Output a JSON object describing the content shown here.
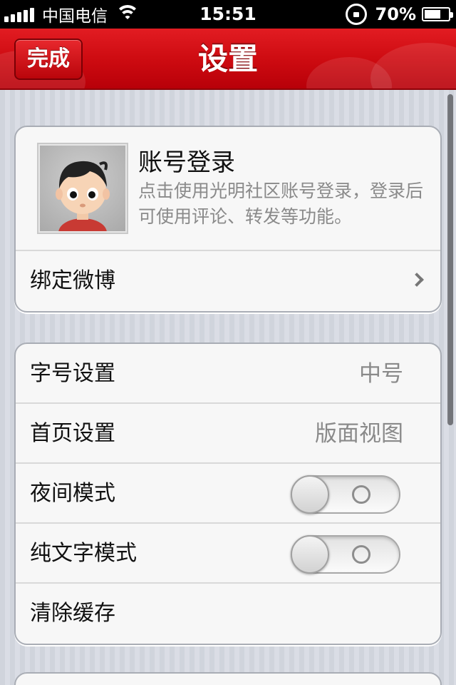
{
  "status_bar": {
    "carrier": "中国电信",
    "time": "15:51",
    "battery_percent": "70%",
    "battery_level": 0.7
  },
  "nav": {
    "title": "设置",
    "done_label": "完成"
  },
  "account": {
    "title": "账号登录",
    "description": "点击使用光明社区账号登录，登录后可使用评论、转发等功能。",
    "bind_weibo_label": "绑定微博"
  },
  "settings": {
    "font_size": {
      "label": "字号设置",
      "value": "中号"
    },
    "home_page": {
      "label": "首页设置",
      "value": "版面视图"
    },
    "night_mode": {
      "label": "夜间模式",
      "on": false
    },
    "text_only": {
      "label": "纯文字模式",
      "on": false
    },
    "clear_cache": {
      "label": "清除缓存"
    }
  },
  "colors": {
    "nav_red": "#cc0a10",
    "background": "#d5d9e1"
  }
}
